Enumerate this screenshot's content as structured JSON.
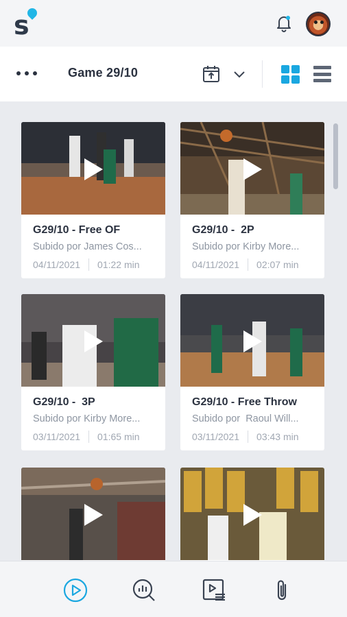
{
  "header": {
    "logo_letter": "s",
    "icons": {
      "notifications": "bell-icon",
      "profile": "avatar"
    },
    "accent_color": "#21b6e6"
  },
  "toolbar": {
    "more_icon": "more-horizontal-icon",
    "title": "Game 29/10",
    "calendar_icon": "calendar-upload-icon",
    "dropdown_icon": "chevron-down-icon",
    "view_modes": [
      {
        "name": "grid",
        "active": true
      },
      {
        "name": "list",
        "active": false
      }
    ]
  },
  "videos": [
    {
      "title": "G29/10 - Free OF",
      "uploader": "Subido por James Cos...",
      "date": "04/11/2021",
      "duration": "01:22 min"
    },
    {
      "title": "G29/10 -  2P",
      "uploader": "Subido por Kirby More...",
      "date": "04/11/2021",
      "duration": "02:07 min"
    },
    {
      "title": "G29/10 -  3P",
      "uploader": "Subido por Kirby More...",
      "date": "03/11/2021",
      "duration": "01:65 min"
    },
    {
      "title": "G29/10 - Free Throw",
      "uploader": "Subido por  Raoul Will...",
      "date": "03/11/2021",
      "duration": "03:43 min"
    },
    {
      "title": "",
      "uploader": "",
      "date": "",
      "duration": ""
    },
    {
      "title": "",
      "uploader": "",
      "date": "",
      "duration": ""
    }
  ],
  "bottom_nav": [
    {
      "icon": "play-circle-icon",
      "active": true
    },
    {
      "icon": "analytics-search-icon",
      "active": false
    },
    {
      "icon": "video-playlist-icon",
      "active": false
    },
    {
      "icon": "paperclip-icon",
      "active": false
    }
  ],
  "colors": {
    "active": "#1aa7e0",
    "inactive": "#3a4352"
  }
}
